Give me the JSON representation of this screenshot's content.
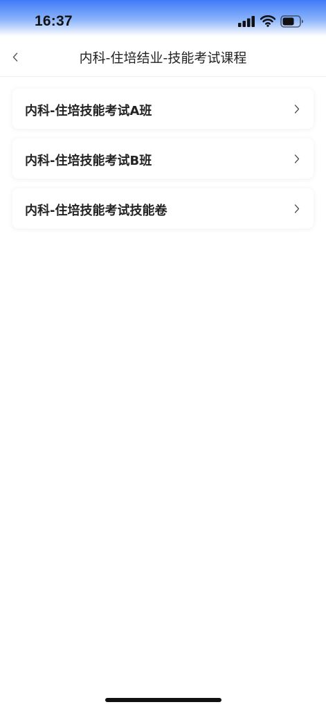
{
  "status_bar": {
    "time": "16:37",
    "icons": [
      "cellular-signal-icon",
      "wifi-icon",
      "battery-icon"
    ]
  },
  "nav": {
    "back_icon": "chevron-left-icon",
    "title": "内科-住培结业-技能考试课程"
  },
  "courses": [
    {
      "label": "内科-住培技能考试A班",
      "icon": "chevron-right-icon"
    },
    {
      "label": "内科-住培技能考试B班",
      "icon": "chevron-right-icon"
    },
    {
      "label": "内科-住培技能考试技能卷",
      "icon": "chevron-right-icon"
    }
  ],
  "colors": {
    "status_gradient_top": "#3f7bf6",
    "text_primary": "#222222",
    "chevron": "#555555",
    "divider": "#eeeeee"
  }
}
